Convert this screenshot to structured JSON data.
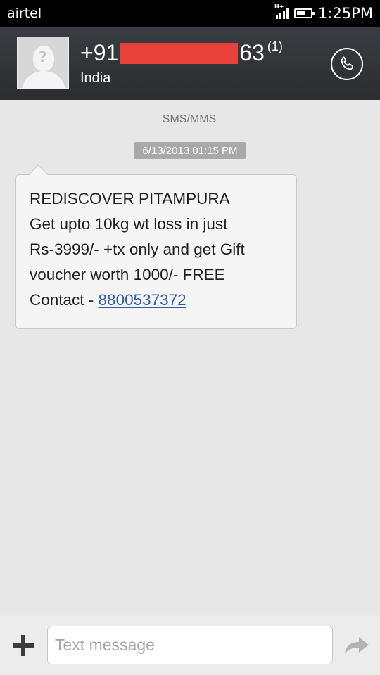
{
  "status_bar": {
    "carrier": "airtel",
    "network": "H+",
    "time": "1:25PM"
  },
  "contact": {
    "number_prefix": "+91",
    "number_suffix": "63",
    "message_count": "(1)",
    "country": "India"
  },
  "thread": {
    "divider_label": "SMS/MMS",
    "timestamp": "6/13/2013 01:15 PM",
    "message": {
      "lines": [
        "REDISCOVER PITAMPURA",
        "Get upto 10kg wt loss in just",
        "Rs-3999/- +tx only and get Gift",
        "voucher worth 1000/- FREE"
      ],
      "contact_label": "Contact - ",
      "contact_number": "8800537372"
    }
  },
  "compose": {
    "placeholder": "Text message",
    "value": ""
  },
  "icons": {
    "call": "phone-icon",
    "add": "plus-icon",
    "send": "send-arrow-icon",
    "avatar": "contact-placeholder-icon"
  },
  "colors": {
    "header_bg": "#2b2d30",
    "redaction": "#e8403b",
    "link": "#2f5fa8"
  }
}
